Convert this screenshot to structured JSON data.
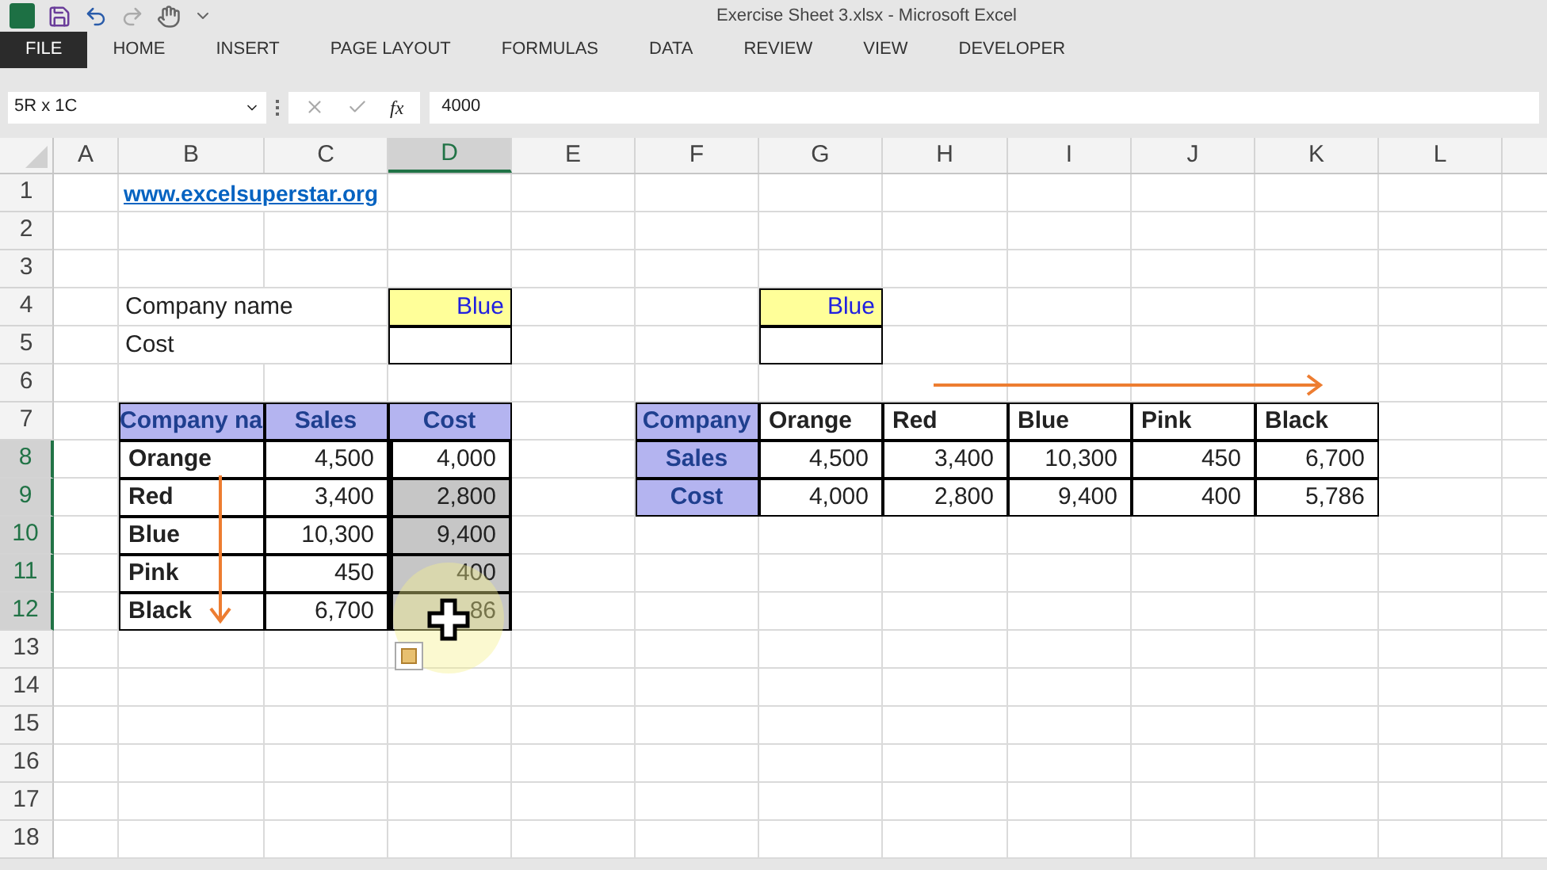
{
  "window": {
    "title": "Exercise Sheet 3.xlsx - Microsoft Excel"
  },
  "ribbon_tabs": [
    {
      "label": "FILE",
      "selected": true
    },
    {
      "label": "HOME",
      "selected": false
    },
    {
      "label": "INSERT",
      "selected": false
    },
    {
      "label": "PAGE LAYOUT",
      "selected": false
    },
    {
      "label": "FORMULAS",
      "selected": false
    },
    {
      "label": "DATA",
      "selected": false
    },
    {
      "label": "REVIEW",
      "selected": false
    },
    {
      "label": "VIEW",
      "selected": false
    },
    {
      "label": "DEVELOPER",
      "selected": false
    }
  ],
  "formula_bar": {
    "name_box": "5R x 1C",
    "function_label": "fx",
    "value": "4000"
  },
  "columns": [
    {
      "label": "A",
      "selected": false
    },
    {
      "label": "B",
      "selected": false
    },
    {
      "label": "C",
      "selected": false
    },
    {
      "label": "D",
      "selected": true
    },
    {
      "label": "E",
      "selected": false
    },
    {
      "label": "F",
      "selected": false
    },
    {
      "label": "G",
      "selected": false
    },
    {
      "label": "H",
      "selected": false
    },
    {
      "label": "I",
      "selected": false
    },
    {
      "label": "J",
      "selected": false
    },
    {
      "label": "K",
      "selected": false
    },
    {
      "label": "L",
      "selected": false
    }
  ],
  "rows": [
    {
      "number": "1",
      "selected": false,
      "cells": [
        {
          "kind": "empty"
        },
        {
          "kind": "link",
          "text": "www.excelsuperstar.org"
        }
      ]
    },
    {
      "number": "2",
      "selected": false,
      "cells": []
    },
    {
      "number": "3",
      "selected": false,
      "cells": []
    },
    {
      "number": "4",
      "selected": false,
      "cells": [
        {
          "kind": "empty"
        },
        {
          "kind": "label",
          "text": "Company name"
        },
        {
          "kind": "empty"
        },
        {
          "kind": "input",
          "text": "Blue"
        },
        {
          "kind": "empty"
        },
        {
          "kind": "empty"
        },
        {
          "kind": "input",
          "text": "Blue"
        }
      ]
    },
    {
      "number": "5",
      "selected": false,
      "cells": [
        {
          "kind": "empty"
        },
        {
          "kind": "label",
          "text": "Cost"
        },
        {
          "kind": "empty"
        },
        {
          "kind": "box"
        },
        {
          "kind": "empty"
        },
        {
          "kind": "empty"
        },
        {
          "kind": "box"
        }
      ]
    },
    {
      "number": "6",
      "selected": false,
      "cells": []
    },
    {
      "number": "7",
      "selected": false,
      "cells": [
        {
          "kind": "empty"
        },
        {
          "kind": "header",
          "text": "Company na"
        },
        {
          "kind": "header",
          "text": "Sales"
        },
        {
          "kind": "header",
          "text": "Cost"
        },
        {
          "kind": "empty"
        },
        {
          "kind": "header",
          "text": "Company"
        },
        {
          "kind": "name",
          "text": "Orange"
        },
        {
          "kind": "name",
          "text": "Red"
        },
        {
          "kind": "name",
          "text": "Blue"
        },
        {
          "kind": "name",
          "text": "Pink"
        },
        {
          "kind": "name",
          "text": "Black"
        }
      ]
    },
    {
      "number": "8",
      "selected": true,
      "cells": [
        {
          "kind": "empty"
        },
        {
          "kind": "name",
          "text": "Orange"
        },
        {
          "kind": "number",
          "text": "4,500"
        },
        {
          "kind": "number",
          "text": "4,000",
          "selected": true,
          "active": true
        },
        {
          "kind": "empty"
        },
        {
          "kind": "header",
          "text": "Sales"
        },
        {
          "kind": "number",
          "text": "4,500"
        },
        {
          "kind": "number",
          "text": "3,400"
        },
        {
          "kind": "number",
          "text": "10,300"
        },
        {
          "kind": "number",
          "text": "450"
        },
        {
          "kind": "number",
          "text": "6,700"
        }
      ]
    },
    {
      "number": "9",
      "selected": true,
      "cells": [
        {
          "kind": "empty"
        },
        {
          "kind": "name",
          "text": "Red"
        },
        {
          "kind": "number",
          "text": "3,400"
        },
        {
          "kind": "number",
          "text": "2,800",
          "selected": true,
          "active": false
        },
        {
          "kind": "empty"
        },
        {
          "kind": "header",
          "text": "Cost"
        },
        {
          "kind": "number",
          "text": "4,000"
        },
        {
          "kind": "number",
          "text": "2,800"
        },
        {
          "kind": "number",
          "text": "9,400"
        },
        {
          "kind": "number",
          "text": "400"
        },
        {
          "kind": "number",
          "text": "5,786"
        }
      ]
    },
    {
      "number": "10",
      "selected": true,
      "cells": [
        {
          "kind": "empty"
        },
        {
          "kind": "name",
          "text": "Blue"
        },
        {
          "kind": "number",
          "text": "10,300"
        },
        {
          "kind": "number",
          "text": "9,400",
          "selected": true,
          "active": false
        }
      ]
    },
    {
      "number": "11",
      "selected": true,
      "cells": [
        {
          "kind": "empty"
        },
        {
          "kind": "name",
          "text": "Pink"
        },
        {
          "kind": "number",
          "text": "450"
        },
        {
          "kind": "number",
          "text": "400",
          "selected": true,
          "active": false
        }
      ]
    },
    {
      "number": "12",
      "selected": true,
      "cells": [
        {
          "kind": "empty"
        },
        {
          "kind": "name",
          "text": "Black"
        },
        {
          "kind": "number",
          "text": "6,700"
        },
        {
          "kind": "number",
          "text": "86",
          "selected": true,
          "active": false
        }
      ]
    },
    {
      "number": "13",
      "selected": false,
      "cells": []
    },
    {
      "number": "14",
      "selected": false,
      "cells": []
    },
    {
      "number": "15",
      "selected": false,
      "cells": []
    },
    {
      "number": "16",
      "selected": false,
      "cells": []
    },
    {
      "number": "17",
      "selected": false,
      "cells": []
    },
    {
      "number": "18",
      "selected": false,
      "cells": []
    }
  ]
}
